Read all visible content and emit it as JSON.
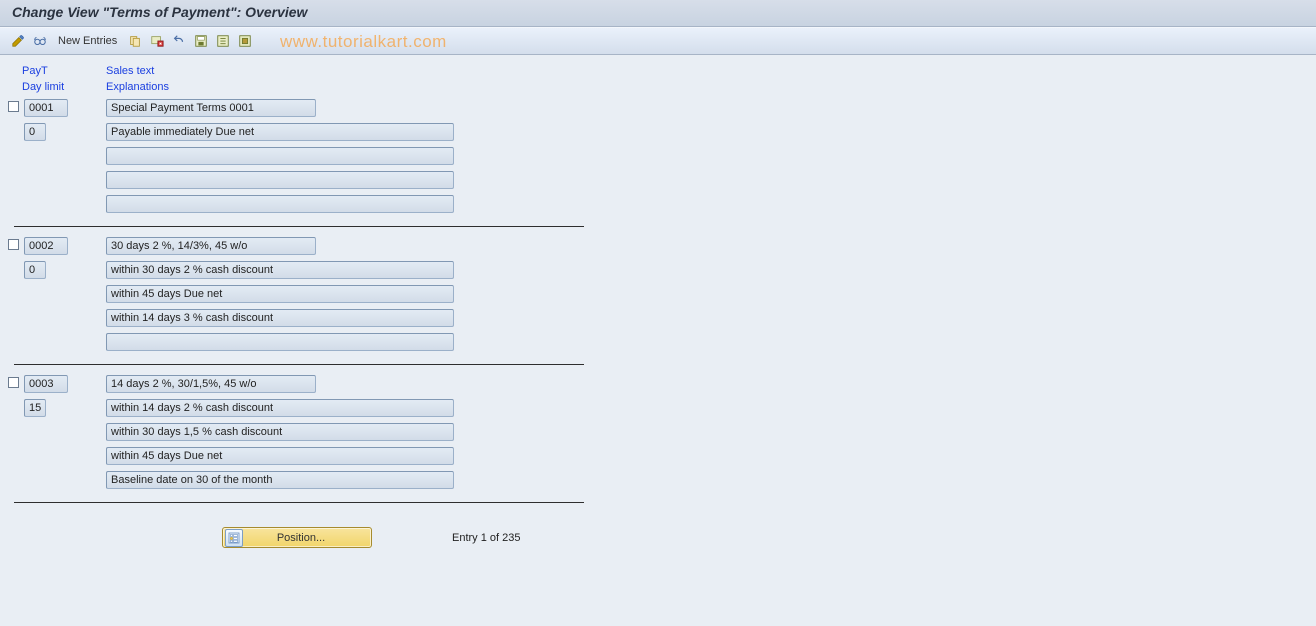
{
  "title": "Change View \"Terms of Payment\": Overview",
  "toolbar": {
    "new_entries_label": "New Entries"
  },
  "watermark": "www.tutorialkart.com",
  "headers": {
    "payt": "PayT",
    "sales_text": "Sales text",
    "day_limit": "Day limit",
    "explanations": "Explanations"
  },
  "entries": [
    {
      "payt": "0001",
      "day_limit": "0",
      "sales_text": "Special Payment Terms 0001",
      "explanations": [
        "Payable immediately Due net",
        "",
        "",
        ""
      ]
    },
    {
      "payt": "0002",
      "day_limit": "0",
      "sales_text": "30 days 2 %, 14/3%, 45 w/o",
      "explanations": [
        "within 30 days 2 % cash discount",
        "within 45 days Due net",
        "within 14 days 3 % cash discount",
        ""
      ]
    },
    {
      "payt": "0003",
      "day_limit": "15",
      "sales_text": "14 days 2 %, 30/1,5%, 45 w/o",
      "explanations": [
        "within 14 days 2 % cash discount",
        "within 30 days 1,5 % cash discount",
        "within 45 days Due net",
        "Baseline date on 30 of the month"
      ]
    }
  ],
  "footer": {
    "position_label": "Position...",
    "entry_counter": "Entry 1 of 235"
  }
}
